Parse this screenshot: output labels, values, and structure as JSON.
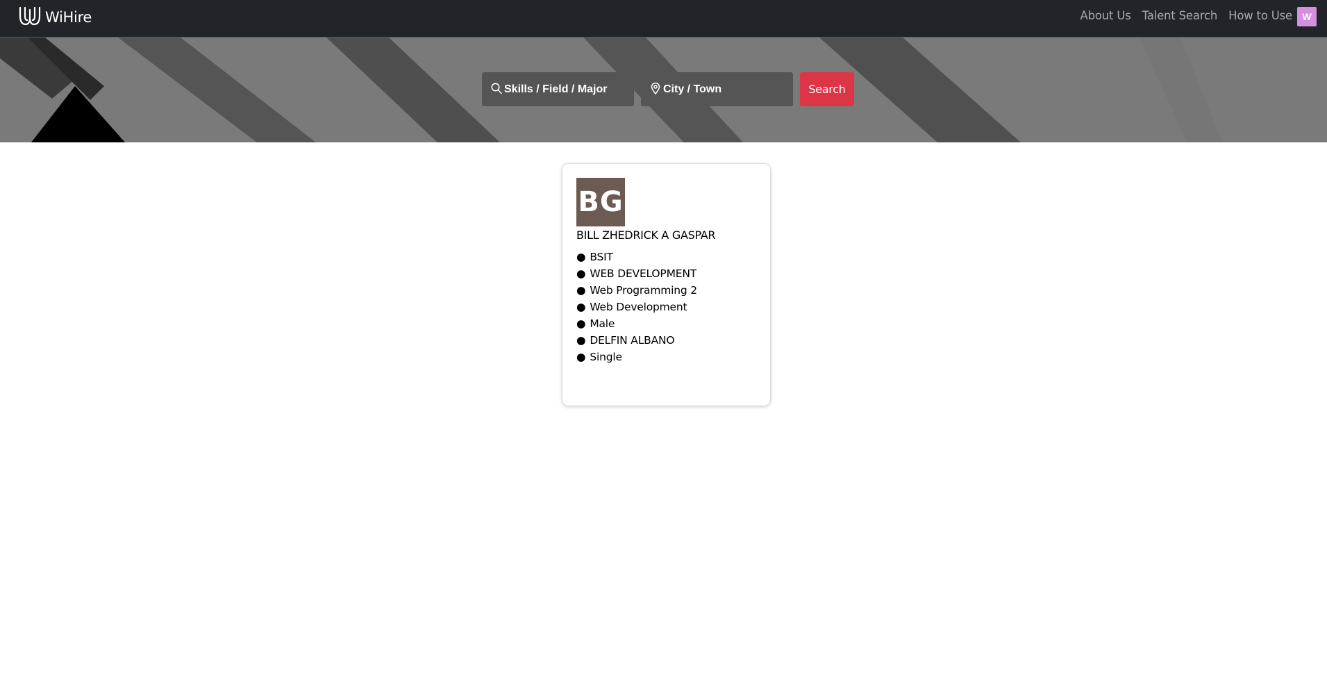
{
  "navbar": {
    "brand": "WiHire",
    "links": [
      "About Us",
      "Talent Search",
      "How to Use"
    ],
    "avatar_letter": "W",
    "avatar_color": "#d68fe0"
  },
  "search": {
    "skills_placeholder": "Skills / Field / Major",
    "city_placeholder": "City / Town",
    "button_label": "Search",
    "button_color": "#dc3545"
  },
  "profile": {
    "initials": "BG",
    "name": "BILL ZHEDRICK A GASPAR",
    "bullet": "●",
    "details": [
      "BSIT",
      "WEB DEVELOPMENT",
      "Web Programming 2",
      "Web Development",
      "Male",
      "DELFIN ALBANO",
      "Single"
    ]
  }
}
